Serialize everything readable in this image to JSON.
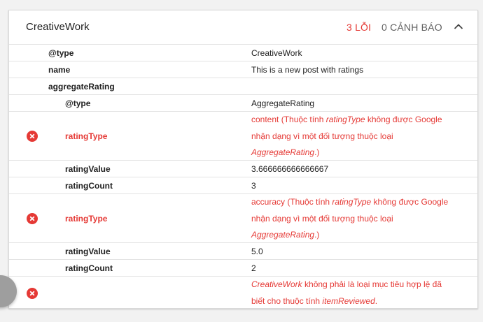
{
  "card": {
    "title": "CreativeWork",
    "errors": "3 LỖI",
    "warnings": "0 CẢNH BÁO"
  },
  "rows": [
    {
      "label": "@type",
      "value": "CreativeWork"
    },
    {
      "label": "name",
      "value": "This is a new post with ratings"
    },
    {
      "label": "aggregateRating",
      "value": ""
    },
    {
      "label": "@type",
      "value": "AggregateRating"
    },
    {
      "label": "ratingType",
      "value": {
        "line1": "content (Thuộc tính ",
        "em1": "ratingType",
        "line1b": " không được Google",
        "line2": "nhận dạng vì một đối tượng thuộc loại",
        "em2": "AggregateRating",
        "line3b": ".)"
      }
    },
    {
      "label": "ratingValue",
      "value": "3.666666666666667"
    },
    {
      "label": "ratingCount",
      "value": "3"
    },
    {
      "label": "ratingType",
      "value": {
        "line1": "accuracy (Thuộc tính ",
        "em1": "ratingType",
        "line1b": " không được Google",
        "line2": "nhận dạng vì một đối tượng thuộc loại",
        "em2": "AggregateRating",
        "line3b": ".)"
      }
    },
    {
      "label": "ratingValue",
      "value": "5.0"
    },
    {
      "label": "ratingCount",
      "value": "2"
    },
    {
      "label": "",
      "value": {
        "em1": "CreativeWork",
        "line1b": " không phải là loại mục tiêu hợp lệ đã",
        "line2a": "biết cho thuộc tính ",
        "em2": "itemReviewed",
        "line2b": "."
      }
    }
  ],
  "icons": {
    "error": "error-circle-icon",
    "collapse": "chevron-up-icon"
  },
  "colors": {
    "error": "#e53935",
    "text": "#212121",
    "muted": "#616161"
  }
}
